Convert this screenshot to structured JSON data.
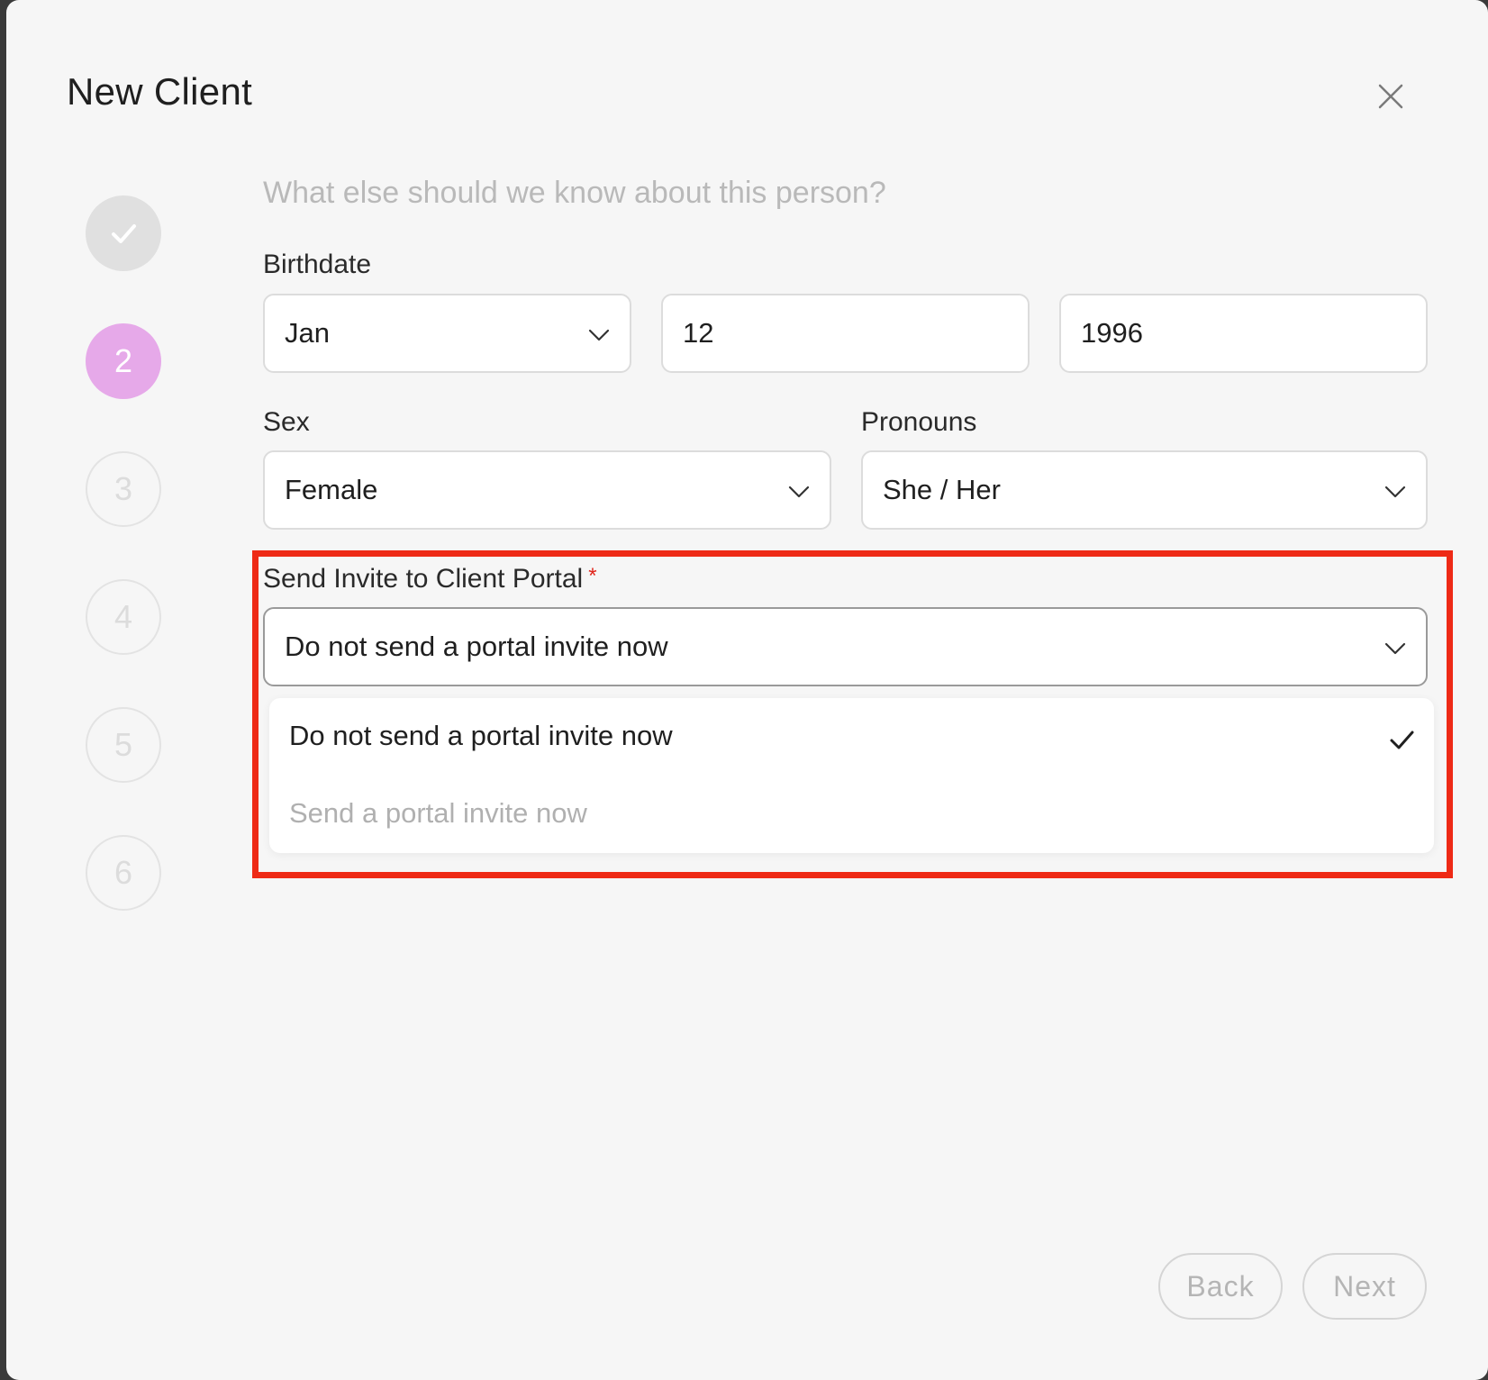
{
  "modal": {
    "title": "New Client",
    "prompt": "What else should we know about this person?"
  },
  "stepper": {
    "steps": [
      "",
      "2",
      "3",
      "4",
      "5",
      "6"
    ],
    "current_step": 2
  },
  "birthdate": {
    "label": "Birthdate",
    "month": "Jan",
    "day": "12",
    "year": "1996"
  },
  "sex": {
    "label": "Sex",
    "value": "Female"
  },
  "pronouns": {
    "label": "Pronouns",
    "value": "She / Her"
  },
  "portal_invite": {
    "label": "Send Invite to Client Portal",
    "required_mark": "*",
    "value": "Do not send a portal invite now",
    "options": [
      {
        "label": "Do not send a portal invite now",
        "selected": true
      },
      {
        "label": "Send a portal invite now",
        "selected": false
      }
    ]
  },
  "footer": {
    "back_label": "Back",
    "next_label": "Next"
  },
  "colors": {
    "active_step": "#e6a9e9",
    "highlight": "#ee2a16",
    "required": "#e0251b"
  }
}
